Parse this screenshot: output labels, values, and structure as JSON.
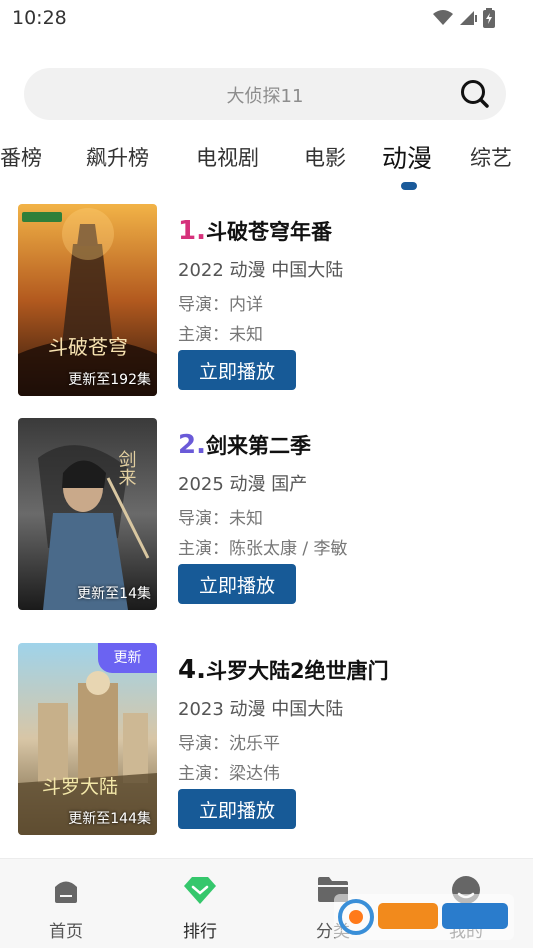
{
  "status_bar": {
    "time": "10:28"
  },
  "search": {
    "placeholder": "大侦探11"
  },
  "tabs": [
    {
      "label": "番榜"
    },
    {
      "label": "飙升榜"
    },
    {
      "label": "电视剧"
    },
    {
      "label": "电影"
    },
    {
      "label": "动漫",
      "active": true
    },
    {
      "label": "综艺"
    }
  ],
  "items": [
    {
      "rank": "1.",
      "rank_color": "#d6317b",
      "title": "斗破苍穹年番",
      "meta": "2022  动漫  中国大陆",
      "director": "导演：内详",
      "actors": "主演：未知",
      "play": "立即播放",
      "caption": "更新至192集",
      "poster_text": "斗破苍穹"
    },
    {
      "rank": "2.",
      "rank_color": "#6a5ad8",
      "title": "剑来第二季",
      "meta": "2025  动漫  国产",
      "director": "导演：未知",
      "actors": "主演：陈张太康 / 李敏",
      "play": "立即播放",
      "caption": "更新至14集",
      "poster_text": "剑来"
    },
    {
      "rank": "4.",
      "rank_color": "#111111",
      "title": "斗罗大陆2绝世唐门",
      "meta": "2023  动漫  中国大陆",
      "director": "导演：沈乐平",
      "actors": "主演：梁达伟",
      "play": "立即播放",
      "caption": "更新至144集",
      "badge": "更新",
      "poster_text": "斗罗大陆"
    }
  ],
  "bottom_nav": [
    {
      "label": "首页",
      "icon": "home-icon"
    },
    {
      "label": "排行",
      "icon": "ranking-icon",
      "active": true
    },
    {
      "label": "分类",
      "icon": "folder-icon"
    },
    {
      "label": "我的",
      "icon": "profile-icon"
    }
  ],
  "colors": {
    "accent": "#175a97",
    "active_nav": "#2ecc71"
  }
}
